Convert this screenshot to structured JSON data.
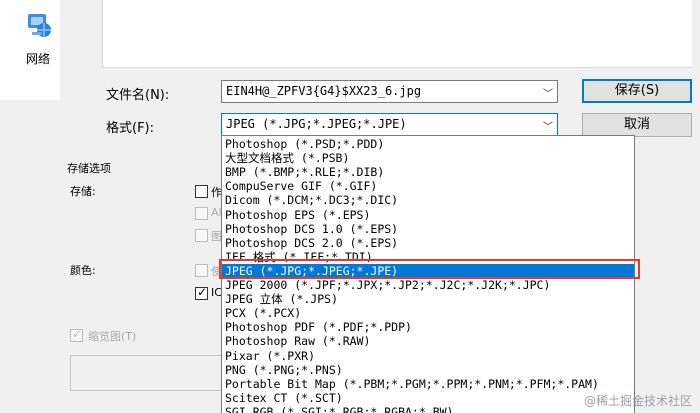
{
  "nav": {
    "network_label": "网络"
  },
  "fields": {
    "filename_label": "文件名(N):",
    "filename_value": "EIN4H@_ZPFV3{G4}$XX23_6.jpg",
    "format_label": "格式(F):",
    "format_value": "JPEG (*.JPG;*.JPEG;*.JPE)"
  },
  "buttons": {
    "save": "保存(S)",
    "cancel": "取消"
  },
  "options": {
    "section_title": "存储选项",
    "storage_label": "存储:",
    "storage_cut_1": "作",
    "storage_cut_2": "Al",
    "storage_cut_3": "图",
    "color_label": "颜色:",
    "color_cut_1": "使",
    "color_cut_2": "IC",
    "thumbnail_label": "缩览图(T)"
  },
  "format_list": [
    "Photoshop (*.PSD;*.PDD)",
    "大型文档格式 (*.PSB)",
    "BMP (*.BMP;*.RLE;*.DIB)",
    "CompuServe GIF (*.GIF)",
    "Dicom (*.DCM;*.DC3;*.DIC)",
    "Photoshop EPS (*.EPS)",
    "Photoshop DCS 1.0 (*.EPS)",
    "Photoshop DCS 2.0 (*.EPS)",
    "IFF 格式 (*.IFF;*.TDI)",
    "JPEG (*.JPG;*.JPEG;*.JPE)",
    "JPEG 2000 (*.JPF;*.JPX;*.JP2;*.J2C;*.J2K;*.JPC)",
    "JPEG 立体 (*.JPS)",
    "PCX (*.PCX)",
    "Photoshop PDF (*.PDF;*.PDP)",
    "Photoshop Raw (*.RAW)",
    "Pixar (*.PXR)",
    "PNG (*.PNG;*.PNS)",
    "Portable Bit Map (*.PBM;*.PGM;*.PPM;*.PNM;*.PFM;*.PAM)",
    "Scitex CT (*.SCT)",
    "SGI RGB (*.SGI;*.RGB;*.RGBA;*.BW)"
  ],
  "selected_index": 9,
  "colors": {
    "accent": "#0078d7",
    "annotation": "#e53935"
  },
  "watermark": "@稀土掘金技术社区"
}
